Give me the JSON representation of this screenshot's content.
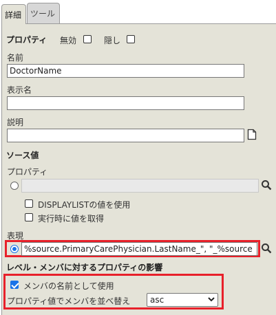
{
  "tabs": [
    {
      "label": "詳細"
    },
    {
      "label": "ツール"
    }
  ],
  "property_row": {
    "title": "プロパティ",
    "disabled_label": "無効",
    "hidden_label": "隠し"
  },
  "name": {
    "label": "名前",
    "value": "DoctorName"
  },
  "display_name": {
    "label": "表示名",
    "value": ""
  },
  "description": {
    "label": "説明",
    "value": ""
  },
  "source_section": {
    "title": "ソース値",
    "property_label": "プロパティ",
    "property_value": "",
    "displaylist_label": "DISPLAYLISTの値を使用",
    "runtime_label": "実行時に値を取得"
  },
  "expression": {
    "label": "表現",
    "value": "%source.PrimaryCarePhysician.LastName_\", \"_%source"
  },
  "level_section": {
    "title": "レベル・メンバに対するプロパティの影響",
    "use_as_name_label": "メンバの名前として使用",
    "sort_label": "プロパティ値でメンバを並べ替え",
    "sort_value": "asc"
  },
  "colors": {
    "panel": "#e4e3d8",
    "highlight": "#e8202a",
    "accent": "#1a73e8"
  }
}
